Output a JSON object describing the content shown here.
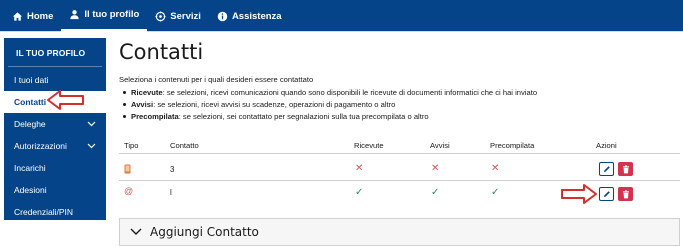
{
  "topnav": {
    "items": [
      {
        "label": "Home",
        "icon": "home-icon"
      },
      {
        "label": "Il tuo profilo",
        "icon": "user-icon",
        "active": true
      },
      {
        "label": "Servizi",
        "icon": "services-icon"
      },
      {
        "label": "Assistenza",
        "icon": "info-icon"
      }
    ]
  },
  "sidebar": {
    "title": "IL TUO PROFILO",
    "items": [
      {
        "label": "I tuoi dati"
      },
      {
        "label": "Contatti",
        "active": true
      },
      {
        "label": "Deleghe",
        "expandable": true
      },
      {
        "label": "Autorizzazioni",
        "expandable": true
      },
      {
        "label": "Incarichi"
      },
      {
        "label": "Adesioni"
      },
      {
        "label": "Credenziali/PIN"
      }
    ]
  },
  "main": {
    "title": "Contatti",
    "intro": "Seleziona i contenuti per i quali desideri essere contattato",
    "bullets": [
      {
        "term": "Ricevute",
        "text": ": se selezioni, ricevi comunicazioni quando sono disponibili le ricevute di documenti informatici che ci hai inviato"
      },
      {
        "term": "Avvisi",
        "text": ": se selezioni, ricevi avvisi su scadenze, operazioni di pagamento o altro"
      },
      {
        "term": "Precompilata",
        "text": ": se selezioni, sei contattato per segnalazioni sulla tua precompilata o altro"
      }
    ],
    "table": {
      "headers": [
        "Tipo",
        "Contatto",
        "Ricevute",
        "Avvisi",
        "Precompilata",
        "Azioni"
      ],
      "rows": [
        {
          "type_icon": "phone-icon",
          "contact": "3",
          "ricevute": "✕",
          "avvisi": "✕",
          "precompilata": "✕"
        },
        {
          "type_icon": "at-icon",
          "contact": "l",
          "ricevute": "✓",
          "avvisi": "✓",
          "precompilata": "✓"
        }
      ]
    },
    "accordion": {
      "label": "Aggiungi Contatto"
    }
  },
  "colors": {
    "brand_blue": "#06448a",
    "annotation_red": "#d32f2f",
    "delete_red": "#d1344c",
    "check_green": "#2e8b57",
    "cross_red": "#d05a5a"
  }
}
